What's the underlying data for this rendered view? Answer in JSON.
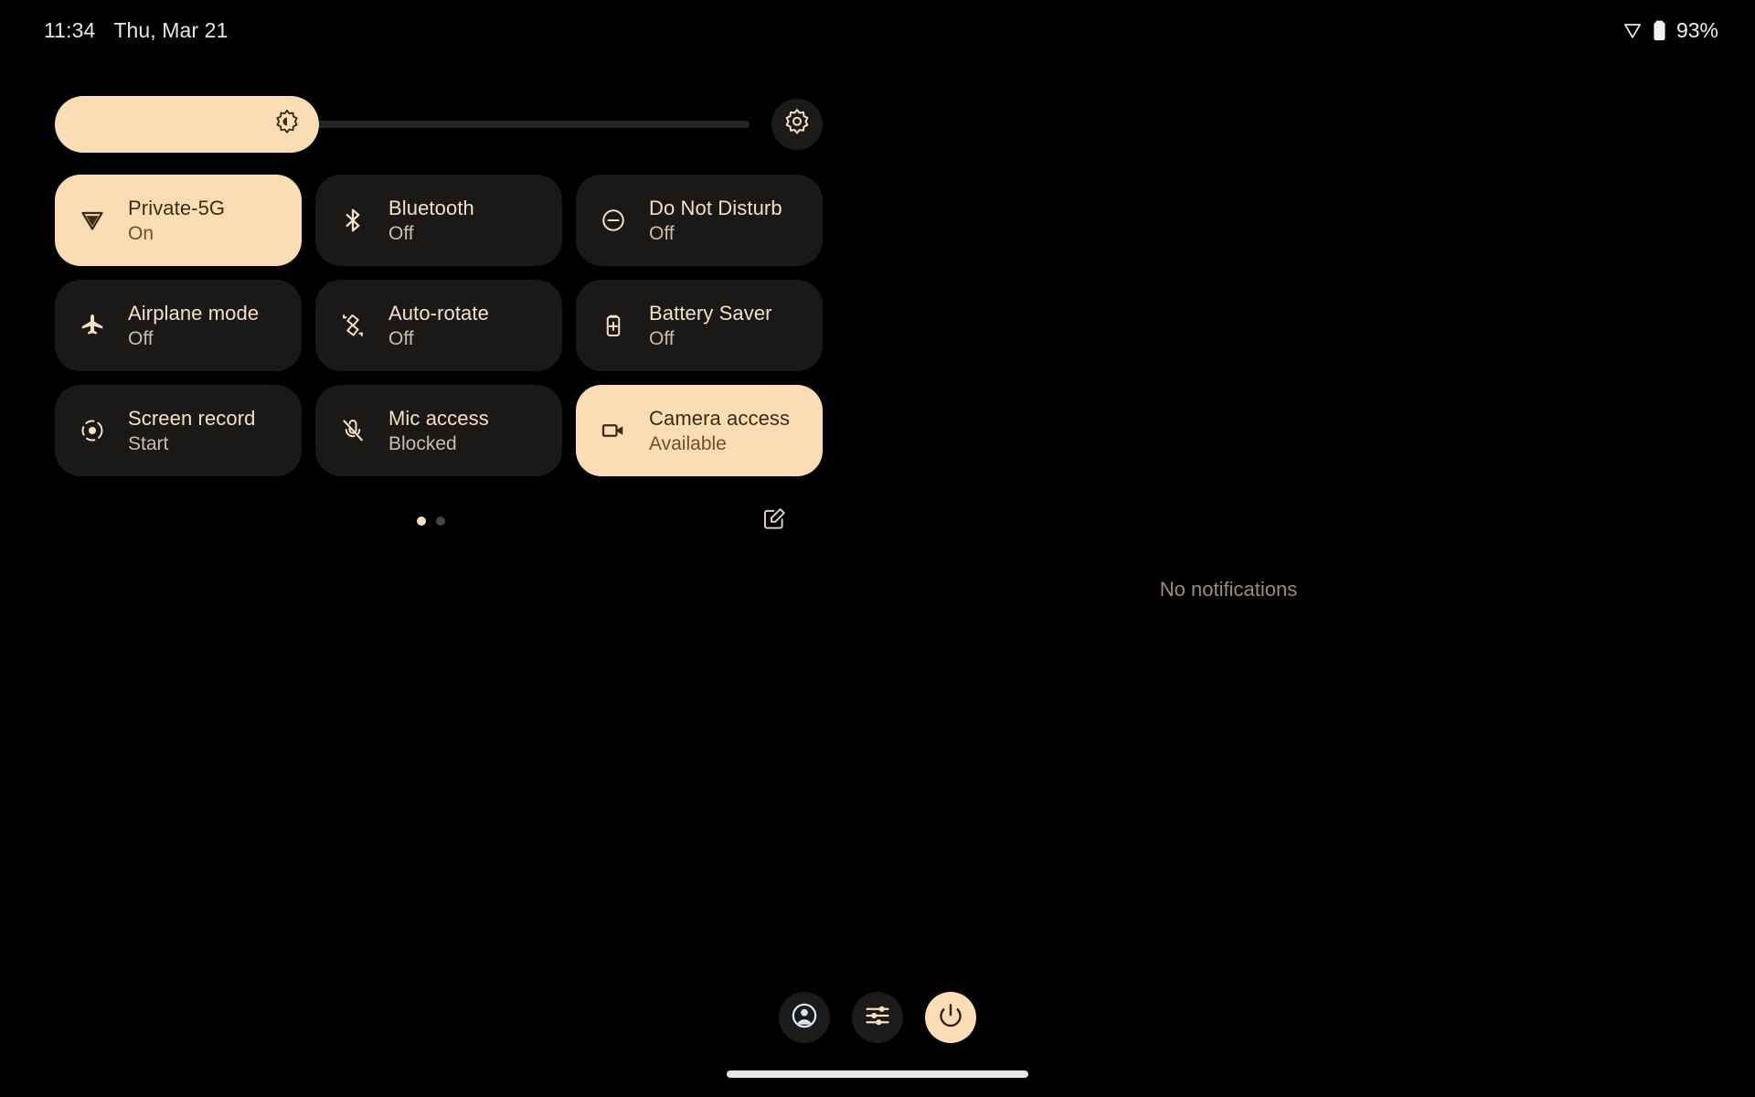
{
  "status_bar": {
    "time": "11:34",
    "date": "Thu, Mar 21",
    "battery_percent": "93%",
    "icons": [
      "private-dns-triangle-icon",
      "battery-icon"
    ]
  },
  "brightness": {
    "name": "brightness-slider",
    "value_percent": 38,
    "icon": "brightness-icon",
    "settings_button_icon": "brightness-auto-icon"
  },
  "tiles": [
    {
      "label": "Private-5G",
      "state": "On",
      "icon": "private-dns-triangle-icon",
      "active": true
    },
    {
      "label": "Bluetooth",
      "state": "Off",
      "icon": "bluetooth-icon",
      "active": false
    },
    {
      "label": "Do Not Disturb",
      "state": "Off",
      "icon": "do-not-disturb-icon",
      "active": false
    },
    {
      "label": "Airplane mode",
      "state": "Off",
      "icon": "airplane-icon",
      "active": false
    },
    {
      "label": "Auto-rotate",
      "state": "Off",
      "icon": "auto-rotate-icon",
      "active": false
    },
    {
      "label": "Battery Saver",
      "state": "Off",
      "icon": "battery-saver-icon",
      "active": false
    },
    {
      "label": "Screen record",
      "state": "Start",
      "icon": "screen-record-icon",
      "active": false
    },
    {
      "label": "Mic access",
      "state": "Blocked",
      "icon": "mic-off-icon",
      "active": false
    },
    {
      "label": "Camera access",
      "state": "Available",
      "icon": "camera-icon",
      "active": true
    }
  ],
  "pager": {
    "total_pages": 2,
    "current_page": 1,
    "edit_icon": "edit-pencil-icon"
  },
  "notifications": {
    "empty_text": "No notifications"
  },
  "bottom_bar": {
    "buttons": [
      {
        "name": "user-switcher-button",
        "icon": "account-circle-icon"
      },
      {
        "name": "settings-button",
        "icon": "sliders-icon"
      },
      {
        "name": "power-button",
        "icon": "power-icon"
      }
    ]
  },
  "colors": {
    "accent": "#FADCB5",
    "tile_inactive": "#1A1918",
    "background": "#000000",
    "text_primary": "#F7DFC2",
    "text_secondary": "#CDBCA6",
    "text_on_accent": "#3A2D16"
  }
}
